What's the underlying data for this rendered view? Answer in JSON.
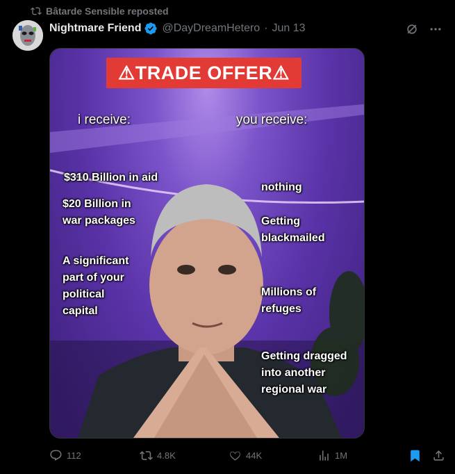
{
  "repost": {
    "text": "Bâtarde Sensible reposted"
  },
  "author": {
    "name": "Nightmare Friend",
    "handle": "@DayDreamHetero",
    "separator": "·",
    "date": "Jun 13"
  },
  "meme": {
    "title": "⚠TRADE OFFER⚠",
    "left_header": "i receive:",
    "right_header": "you receive:",
    "left_items": [
      "$310 Billion in aid",
      "$20 Billion in\nwar packages",
      "A significant\npart of your\npolitical\ncapital"
    ],
    "right_items": [
      "nothing",
      "Getting\nblackmailed",
      "Millions of\nrefuges",
      "Getting dragged\ninto another\nregional war"
    ]
  },
  "actions": {
    "replies": "112",
    "reposts": "4.8K",
    "likes": "44K",
    "views": "1M"
  },
  "colors": {
    "accent": "#1d9bf0",
    "muted": "#71767b",
    "repost_green": "#00ba7c"
  }
}
